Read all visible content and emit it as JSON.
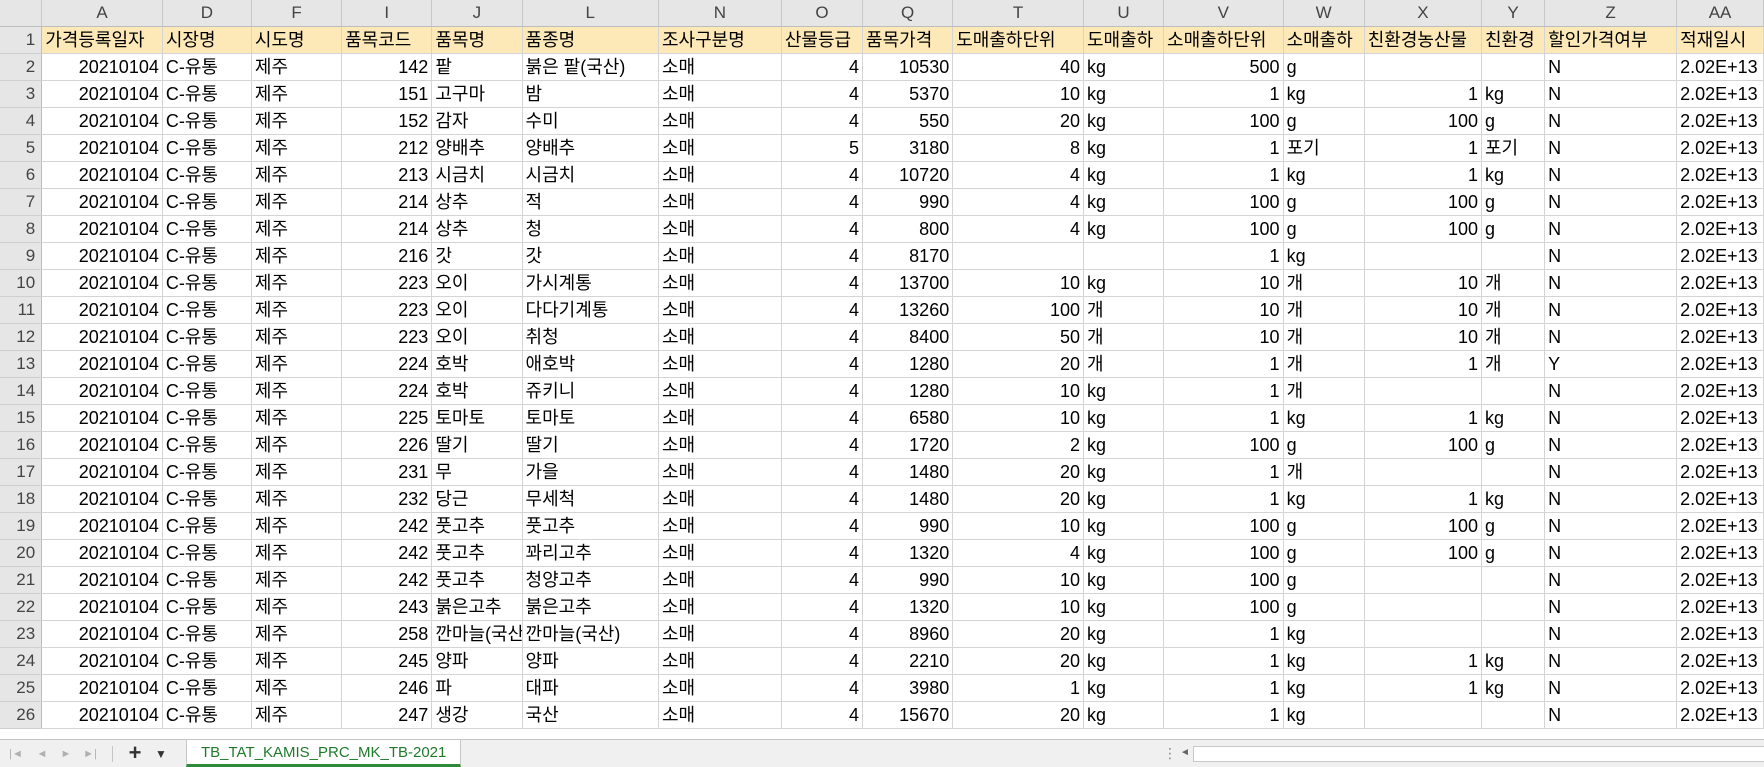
{
  "sheet": {
    "columns": [
      "A",
      "D",
      "F",
      "I",
      "J",
      "L",
      "N",
      "O",
      "Q",
      "T",
      "U",
      "V",
      "W",
      "X",
      "Y",
      "Z",
      "AA"
    ],
    "headers": [
      "가격등록일자",
      "시장명",
      "시도명",
      "품목코드",
      "품목명",
      "품종명",
      "조사구분명",
      "산물등급",
      "품목가격",
      "도매출하단위",
      "도매출하",
      "소매출하단위",
      "소매출하",
      "친환경농산물",
      "친환경",
      "할인가격여부",
      "적재일시"
    ],
    "rows": [
      [
        "20210104",
        "C-유통",
        "제주",
        "142",
        "팥",
        "붉은 팥(국산)",
        "소매",
        "4",
        "10530",
        "40",
        "kg",
        "500",
        "g",
        "",
        "",
        "N",
        "2.02E+13"
      ],
      [
        "20210104",
        "C-유통",
        "제주",
        "151",
        "고구마",
        "밤",
        "소매",
        "4",
        "5370",
        "10",
        "kg",
        "1",
        "kg",
        "1",
        "kg",
        "N",
        "2.02E+13"
      ],
      [
        "20210104",
        "C-유통",
        "제주",
        "152",
        "감자",
        "수미",
        "소매",
        "4",
        "550",
        "20",
        "kg",
        "100",
        "g",
        "100",
        "g",
        "N",
        "2.02E+13"
      ],
      [
        "20210104",
        "C-유통",
        "제주",
        "212",
        "양배추",
        "양배추",
        "소매",
        "5",
        "3180",
        "8",
        "kg",
        "1",
        "포기",
        "1",
        "포기",
        "N",
        "2.02E+13"
      ],
      [
        "20210104",
        "C-유통",
        "제주",
        "213",
        "시금치",
        "시금치",
        "소매",
        "4",
        "10720",
        "4",
        "kg",
        "1",
        "kg",
        "1",
        "kg",
        "N",
        "2.02E+13"
      ],
      [
        "20210104",
        "C-유통",
        "제주",
        "214",
        "상추",
        "적",
        "소매",
        "4",
        "990",
        "4",
        "kg",
        "100",
        "g",
        "100",
        "g",
        "N",
        "2.02E+13"
      ],
      [
        "20210104",
        "C-유통",
        "제주",
        "214",
        "상추",
        "청",
        "소매",
        "4",
        "800",
        "4",
        "kg",
        "100",
        "g",
        "100",
        "g",
        "N",
        "2.02E+13"
      ],
      [
        "20210104",
        "C-유통",
        "제주",
        "216",
        "갓",
        "갓",
        "소매",
        "4",
        "8170",
        "",
        "",
        "1",
        "kg",
        "",
        "",
        "N",
        "2.02E+13"
      ],
      [
        "20210104",
        "C-유통",
        "제주",
        "223",
        "오이",
        "가시계통",
        "소매",
        "4",
        "13700",
        "10",
        "kg",
        "10",
        "개",
        "10",
        "개",
        "N",
        "2.02E+13"
      ],
      [
        "20210104",
        "C-유통",
        "제주",
        "223",
        "오이",
        "다다기계통",
        "소매",
        "4",
        "13260",
        "100",
        "개",
        "10",
        "개",
        "10",
        "개",
        "N",
        "2.02E+13"
      ],
      [
        "20210104",
        "C-유통",
        "제주",
        "223",
        "오이",
        "취청",
        "소매",
        "4",
        "8400",
        "50",
        "개",
        "10",
        "개",
        "10",
        "개",
        "N",
        "2.02E+13"
      ],
      [
        "20210104",
        "C-유통",
        "제주",
        "224",
        "호박",
        "애호박",
        "소매",
        "4",
        "1280",
        "20",
        "개",
        "1",
        "개",
        "1",
        "개",
        "Y",
        "2.02E+13"
      ],
      [
        "20210104",
        "C-유통",
        "제주",
        "224",
        "호박",
        "쥬키니",
        "소매",
        "4",
        "1280",
        "10",
        "kg",
        "1",
        "개",
        "",
        "",
        "N",
        "2.02E+13"
      ],
      [
        "20210104",
        "C-유통",
        "제주",
        "225",
        "토마토",
        "토마토",
        "소매",
        "4",
        "6580",
        "10",
        "kg",
        "1",
        "kg",
        "1",
        "kg",
        "N",
        "2.02E+13"
      ],
      [
        "20210104",
        "C-유통",
        "제주",
        "226",
        "딸기",
        "딸기",
        "소매",
        "4",
        "1720",
        "2",
        "kg",
        "100",
        "g",
        "100",
        "g",
        "N",
        "2.02E+13"
      ],
      [
        "20210104",
        "C-유통",
        "제주",
        "231",
        "무",
        "가을",
        "소매",
        "4",
        "1480",
        "20",
        "kg",
        "1",
        "개",
        "",
        "",
        "N",
        "2.02E+13"
      ],
      [
        "20210104",
        "C-유통",
        "제주",
        "232",
        "당근",
        "무세척",
        "소매",
        "4",
        "1480",
        "20",
        "kg",
        "1",
        "kg",
        "1",
        "kg",
        "N",
        "2.02E+13"
      ],
      [
        "20210104",
        "C-유통",
        "제주",
        "242",
        "풋고추",
        "풋고추",
        "소매",
        "4",
        "990",
        "10",
        "kg",
        "100",
        "g",
        "100",
        "g",
        "N",
        "2.02E+13"
      ],
      [
        "20210104",
        "C-유통",
        "제주",
        "242",
        "풋고추",
        "꽈리고추",
        "소매",
        "4",
        "1320",
        "4",
        "kg",
        "100",
        "g",
        "100",
        "g",
        "N",
        "2.02E+13"
      ],
      [
        "20210104",
        "C-유통",
        "제주",
        "242",
        "풋고추",
        "청양고추",
        "소매",
        "4",
        "990",
        "10",
        "kg",
        "100",
        "g",
        "",
        "",
        "N",
        "2.02E+13"
      ],
      [
        "20210104",
        "C-유통",
        "제주",
        "243",
        "붉은고추",
        "붉은고추",
        "소매",
        "4",
        "1320",
        "10",
        "kg",
        "100",
        "g",
        "",
        "",
        "N",
        "2.02E+13"
      ],
      [
        "20210104",
        "C-유통",
        "제주",
        "258",
        "깐마늘(국산)",
        "깐마늘(국산)",
        "소매",
        "4",
        "8960",
        "20",
        "kg",
        "1",
        "kg",
        "",
        "",
        "N",
        "2.02E+13"
      ],
      [
        "20210104",
        "C-유통",
        "제주",
        "245",
        "양파",
        "양파",
        "소매",
        "4",
        "2210",
        "20",
        "kg",
        "1",
        "kg",
        "1",
        "kg",
        "N",
        "2.02E+13"
      ],
      [
        "20210104",
        "C-유통",
        "제주",
        "246",
        "파",
        "대파",
        "소매",
        "4",
        "3980",
        "1",
        "kg",
        "1",
        "kg",
        "1",
        "kg",
        "N",
        "2.02E+13"
      ],
      [
        "20210104",
        "C-유통",
        "제주",
        "247",
        "생강",
        "국산",
        "소매",
        "4",
        "15670",
        "20",
        "kg",
        "1",
        "kg",
        "",
        "",
        "N",
        "2.02E+13"
      ]
    ]
  },
  "tabbar": {
    "add_label": "+",
    "menu_label": "▼",
    "sheet_tab": "TB_TAT_KAMIS_PRC_MK_TB-2021",
    "scroll_dots": "⋮",
    "scroll_left": "◄"
  }
}
